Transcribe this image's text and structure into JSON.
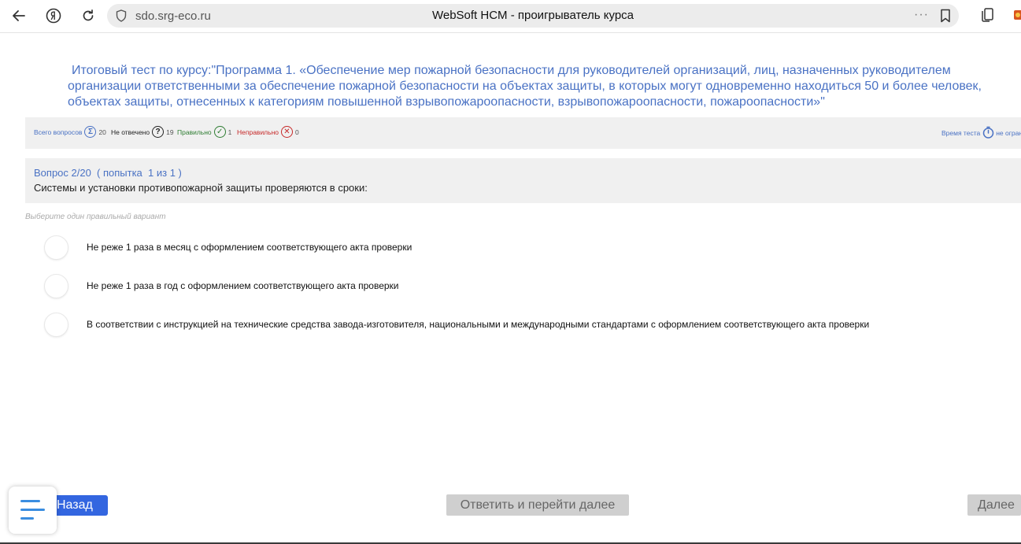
{
  "browser": {
    "url": "sdo.srg-eco.ru",
    "title": "WebSoft HCM - проигрыватель курса",
    "more": "···"
  },
  "test": {
    "title": "Итоговый тест по курсу:\"Программа 1. «Обеспечение мер пожарной безопасности для руководителей организаций, лиц, назначенных руководителем организации ответственными за обеспечение пожарной безопасности на объектах защиты, в которых могут одновременно находиться 50 и более человек, объектах защиты, отнесенных к категориям повышенной взрывопожароопасности, взрывопожароопасности, пожароопасности»\""
  },
  "stats": {
    "total_label": "Всего вопросов",
    "total_icon": "Σ",
    "total_count": "20",
    "unanswered_label": "Не отвечено",
    "unanswered_icon": "?",
    "unanswered_count": "19",
    "correct_label": "Правильно",
    "correct_icon": "✓",
    "correct_count": "1",
    "wrong_label": "Неправильно",
    "wrong_icon": "✕",
    "wrong_count": "0",
    "time_label": "Время теста",
    "time_value": "не огран"
  },
  "question": {
    "number": "Вопрос 2/20  ( попытка  1 из 1 )",
    "text": "Системы и установки противопожарной защиты проверяются в сроки:",
    "hint": "Выберите один правильный вариант"
  },
  "options": [
    "Не реже 1 раза в месяц с оформлением соответствующего акта проверки",
    "Не реже 1 раза в год с оформлением соответствующего акта проверки",
    "В соответствии с инструкцией на технические средства завода-изготовителя, национальными и международными стандартами с оформлением соответствующего акта проверки"
  ],
  "buttons": {
    "back": "Назад",
    "answer": "Ответить и перейти далее",
    "next": "Далее"
  },
  "colors": {
    "accent": "#4a72c4",
    "primary_button": "#3366e0",
    "correct": "#2e7d32",
    "wrong": "#c62828",
    "menu_lines": "#3a8de0"
  }
}
